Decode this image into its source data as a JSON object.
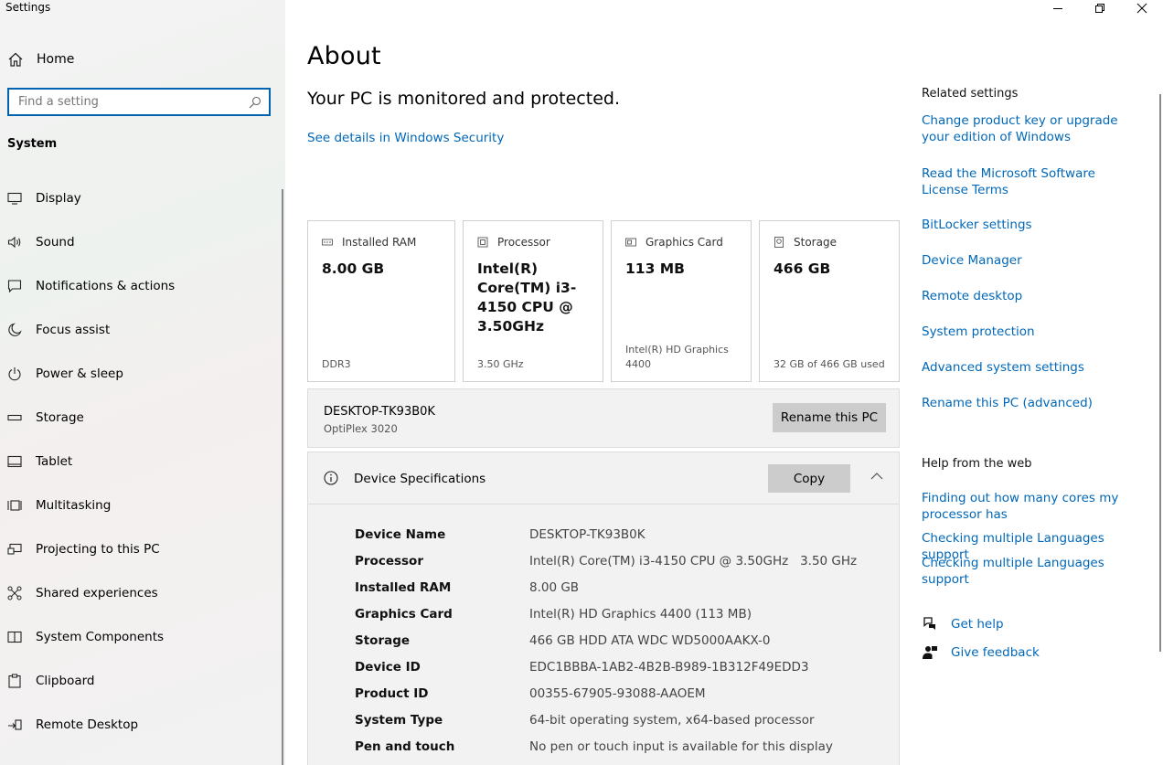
{
  "window": {
    "title": "Settings",
    "minimize_icon": "minimize-icon",
    "restore_icon": "restore-icon",
    "close_icon": "close-icon"
  },
  "sidebar": {
    "home_label": "Home",
    "search_placeholder": "Find a setting",
    "section": "System",
    "items": [
      {
        "label": "Display",
        "icon": "display-icon"
      },
      {
        "label": "Sound",
        "icon": "sound-icon"
      },
      {
        "label": "Notifications & actions",
        "icon": "notifications-icon"
      },
      {
        "label": "Focus assist",
        "icon": "moon-icon"
      },
      {
        "label": "Power & sleep",
        "icon": "power-icon"
      },
      {
        "label": "Storage",
        "icon": "storage-icon"
      },
      {
        "label": "Tablet",
        "icon": "tablet-icon"
      },
      {
        "label": "Multitasking",
        "icon": "multitasking-icon"
      },
      {
        "label": "Projecting to this PC",
        "icon": "projecting-icon"
      },
      {
        "label": "Shared experiences",
        "icon": "shared-experiences-icon"
      },
      {
        "label": "System Components",
        "icon": "system-components-icon"
      },
      {
        "label": "Clipboard",
        "icon": "clipboard-icon"
      },
      {
        "label": "Remote Desktop",
        "icon": "remote-desktop-icon"
      }
    ]
  },
  "main": {
    "title": "About",
    "status": "Your PC is monitored and protected.",
    "security_link": "See details in Windows Security",
    "cards": [
      {
        "label": "Installed RAM",
        "value": "8.00 GB",
        "sub": "DDR3",
        "icon": "ram-icon"
      },
      {
        "label": "Processor",
        "value": "Intel(R) Core(TM) i3-4150 CPU @ 3.50GHz",
        "sub": "3.50 GHz",
        "icon": "processor-icon"
      },
      {
        "label": "Graphics Card",
        "value": "113 MB",
        "sub": "Intel(R) HD Graphics 4400",
        "icon": "graphics-card-icon"
      },
      {
        "label": "Storage",
        "value": "466 GB",
        "sub": "32 GB of 466 GB used",
        "icon": "storage-icon"
      }
    ],
    "pc": {
      "name": "DESKTOP-TK93B0K",
      "model": "OptiPlex 3020",
      "rename_button": "Rename this PC"
    },
    "specs": {
      "title": "Device Specifications",
      "copy_button": "Copy",
      "rows": [
        {
          "key": "Device Name",
          "value": "DESKTOP-TK93B0K"
        },
        {
          "key": "Processor",
          "value": "Intel(R) Core(TM) i3-4150 CPU @ 3.50GHz   3.50 GHz"
        },
        {
          "key": "Installed RAM",
          "value": "8.00 GB"
        },
        {
          "key": "Graphics Card",
          "value": "Intel(R) HD Graphics 4400 (113 MB)"
        },
        {
          "key": "Storage",
          "value": "466 GB HDD ATA WDC WD5000AAKX-0"
        },
        {
          "key": "Device ID",
          "value": "EDC1BBBA-1AB2-4B2B-B989-1B312F49EDD3"
        },
        {
          "key": "Product ID",
          "value": "00355-67905-93088-AAOEM"
        },
        {
          "key": "System Type",
          "value": "64-bit operating system, x64-based processor"
        },
        {
          "key": "Pen and touch",
          "value": "No pen or touch input is available for this display"
        }
      ]
    }
  },
  "right": {
    "related_title": "Related settings",
    "related_links": [
      "Change product key or upgrade your edition of Windows",
      "Read the Microsoft Software License Terms",
      "BitLocker settings",
      "Device Manager",
      "Remote desktop",
      "System protection",
      "Advanced system settings",
      "Rename this PC (advanced)"
    ],
    "help_title": "Help from the web",
    "help_links": [
      "Finding out how many cores my processor has",
      "Checking multiple Languages support",
      "Checking multiple Languages support"
    ],
    "get_help": "Get help",
    "give_feedback": "Give feedback"
  },
  "colors": {
    "accent": "#0067b8",
    "search_border": "#0063b1",
    "button": "#cccccc"
  }
}
